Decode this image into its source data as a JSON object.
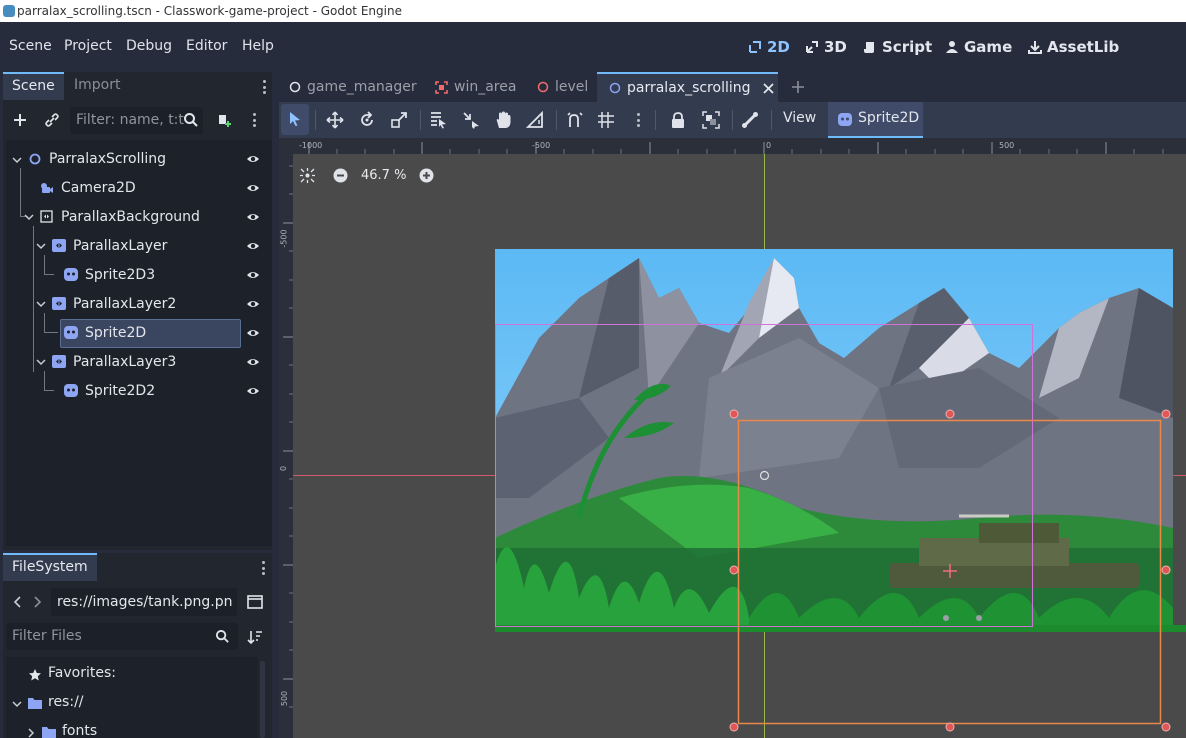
{
  "window": {
    "title": "parralax_scrolling.tscn - Classwork-game-project - Godot Engine"
  },
  "menu": {
    "items": [
      "Scene",
      "Project",
      "Debug",
      "Editor",
      "Help"
    ]
  },
  "main_tabs": [
    {
      "label": "2D",
      "icon": "2d-icon",
      "active": true
    },
    {
      "label": "3D",
      "icon": "3d-icon",
      "active": false
    },
    {
      "label": "Script",
      "icon": "script-icon",
      "active": false
    },
    {
      "label": "Game",
      "icon": "game-icon",
      "active": false
    },
    {
      "label": "AssetLib",
      "icon": "assetlib-icon",
      "active": false
    }
  ],
  "scene_dock": {
    "tabs": [
      "Scene",
      "Import"
    ],
    "active_tab": "Scene",
    "filter_placeholder": "Filter: name, t:t",
    "tree": [
      {
        "name": "ParralaxScrolling",
        "icon": "node2d-icon",
        "depth": 0,
        "expanded": true,
        "selected": false
      },
      {
        "name": "Camera2D",
        "icon": "camera2d-icon",
        "depth": 1,
        "selected": false
      },
      {
        "name": "ParallaxBackground",
        "icon": "parallax-background-icon",
        "depth": 1,
        "expanded": true,
        "selected": false
      },
      {
        "name": "ParallaxLayer",
        "icon": "parallax-layer-icon",
        "depth": 2,
        "expanded": true,
        "selected": false
      },
      {
        "name": "Sprite2D3",
        "icon": "sprite2d-icon",
        "depth": 3,
        "selected": false
      },
      {
        "name": "ParallaxLayer2",
        "icon": "parallax-layer-icon",
        "depth": 2,
        "expanded": true,
        "selected": false
      },
      {
        "name": "Sprite2D",
        "icon": "sprite2d-icon",
        "depth": 3,
        "selected": true
      },
      {
        "name": "ParallaxLayer3",
        "icon": "parallax-layer-icon",
        "depth": 2,
        "expanded": true,
        "selected": false
      },
      {
        "name": "Sprite2D2",
        "icon": "sprite2d-icon",
        "depth": 3,
        "selected": false
      }
    ]
  },
  "filesystem_dock": {
    "tab": "FileSystem",
    "path": "res://images/tank.png.pn",
    "filter_placeholder": "Filter Files",
    "items": [
      {
        "label": "Favorites:",
        "icon": "star-icon"
      },
      {
        "label": "res://",
        "icon": "folder-icon",
        "expanded": true
      },
      {
        "label": "fonts",
        "icon": "folder-icon",
        "expanded": false
      }
    ]
  },
  "editor_tabs": [
    {
      "label": "game_manager",
      "icon": "node-icon",
      "active": false
    },
    {
      "label": "win_area",
      "icon": "area2d-icon",
      "active": false
    },
    {
      "label": "level",
      "icon": "node-icon",
      "active": false
    },
    {
      "label": "parralax_scrolling",
      "icon": "node2d-icon",
      "active": true,
      "closable": true
    }
  ],
  "editor_toolbar": {
    "view_label": "View",
    "selected_node": "Sprite2D"
  },
  "viewport": {
    "zoom": "46.7 %",
    "ruler_top_labels": [
      "-1000",
      "-500",
      "0",
      "500"
    ],
    "ruler_left_labels": [
      "-500",
      "0",
      "500"
    ]
  },
  "colors": {
    "accent": "#70bafa",
    "panel_bg": "#21262f",
    "editor_bg": "#262c3b",
    "viewport_bg": "#4a4a4a",
    "selection_rect": "#f08a3c"
  }
}
